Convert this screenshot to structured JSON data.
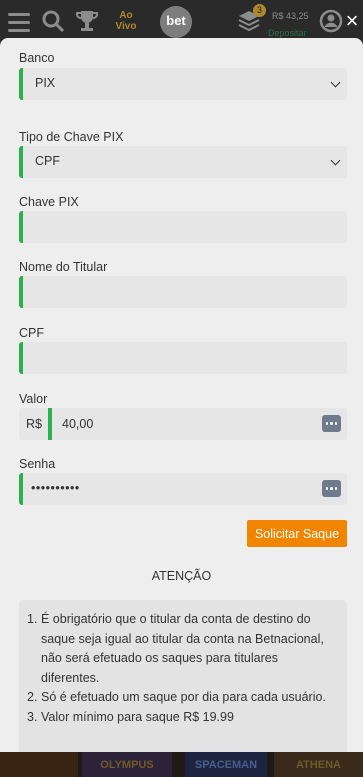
{
  "header": {
    "ao_vivo": "Ao Vivo",
    "logo_text": "bet",
    "stack_count": "3",
    "balance": "R$ 43,25",
    "deposit_label": "Depositar",
    "close_label": "×"
  },
  "form": {
    "banco": {
      "label": "Banco",
      "value": "PIX"
    },
    "tipo_chave": {
      "label": "Tipo de Chave PIX",
      "value": "CPF"
    },
    "chave_pix": {
      "label": "Chave PIX",
      "value": ""
    },
    "nome_titular": {
      "label": "Nome do Titular",
      "value": ""
    },
    "cpf": {
      "label": "CPF",
      "value": ""
    },
    "valor": {
      "label": "Valor",
      "prefix": "R$",
      "value": "40,00"
    },
    "senha": {
      "label": "Senha",
      "value": "••••••••••"
    },
    "submit_label": "Solicitar Saque"
  },
  "notice": {
    "title": "ATENÇÃO",
    "items": [
      {
        "num": "1.",
        "text": "É obrigatório que o titular da conta de destino do saque seja igual ao titular da conta na Betnacional, não será efetuado os saques para titulares diferentes."
      },
      {
        "num": "2.",
        "text": "Só é efetuado um saque por dia para cada usuário."
      },
      {
        "num": "3.",
        "text": "Valor mínimo para saque R$ 19.99"
      }
    ]
  },
  "games": [
    "",
    "OLYMPUS",
    "SPACEMAN",
    "ATHENA"
  ],
  "colors": {
    "accent_green": "#2bb04f",
    "button_orange": "#f18400",
    "panel_bg": "#eeeeee"
  }
}
